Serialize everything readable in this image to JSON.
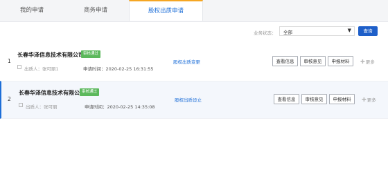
{
  "tabs": [
    {
      "label": "我的申请"
    },
    {
      "label": "商务申请"
    },
    {
      "label": "股权出质申请"
    }
  ],
  "filter": {
    "label": "业务状态：",
    "selected": "全部",
    "search_label": "查询"
  },
  "rows": [
    {
      "index": "1",
      "company": "长春华泽信息技术有限公司1",
      "badge": "审核通过",
      "person": "出质人：张可丽1",
      "time": "申请时间：2020-02-25 16:31:55",
      "type": "股权出质变更",
      "actions": [
        "查看信息",
        "审核意见",
        "申报材料"
      ],
      "more": "更多"
    },
    {
      "index": "2",
      "company": "长春华泽信息技术有限公司",
      "badge": "审核通过",
      "person": "出质人：张可丽",
      "time": "申请时间：2020-02-25 14:35:08",
      "type": "股权出质设立",
      "actions": [
        "查看信息",
        "审核意见",
        "申报材料"
      ],
      "more": "更多"
    }
  ],
  "colors": {
    "accent": "#1e6fd8",
    "tab_highlight": "#f5a623",
    "badge": "#5cb85c",
    "search_button": "#1e5fc9"
  }
}
